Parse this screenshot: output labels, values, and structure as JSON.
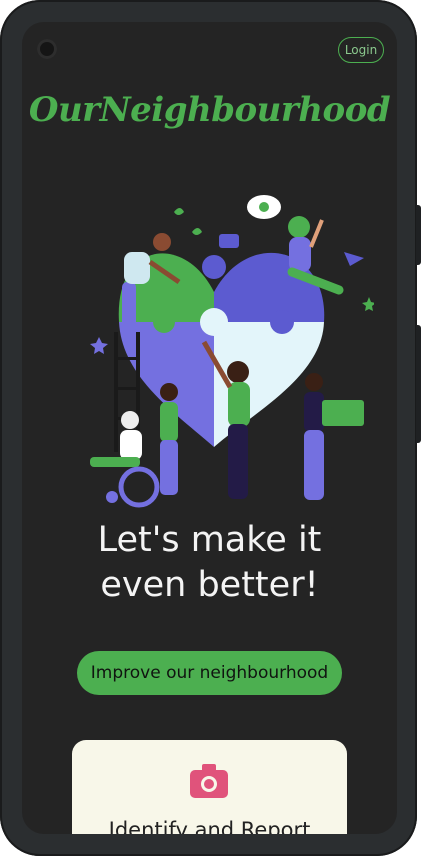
{
  "header": {
    "login_label": "Login"
  },
  "brand": {
    "title": "OurNeighbourhood"
  },
  "hero": {
    "headline_line1": "Let's make it",
    "headline_line2": "even better!"
  },
  "cta": {
    "label": "Improve our neighbourhood"
  },
  "card": {
    "title": "Identify and Report",
    "icon": "camera-icon"
  },
  "colors": {
    "accent": "#4caf50",
    "purple": "#5c5bd0",
    "light_blue": "#e3f5fa",
    "pink": "#e0537b",
    "background": "#242424",
    "card_bg": "#f8f7e9"
  }
}
